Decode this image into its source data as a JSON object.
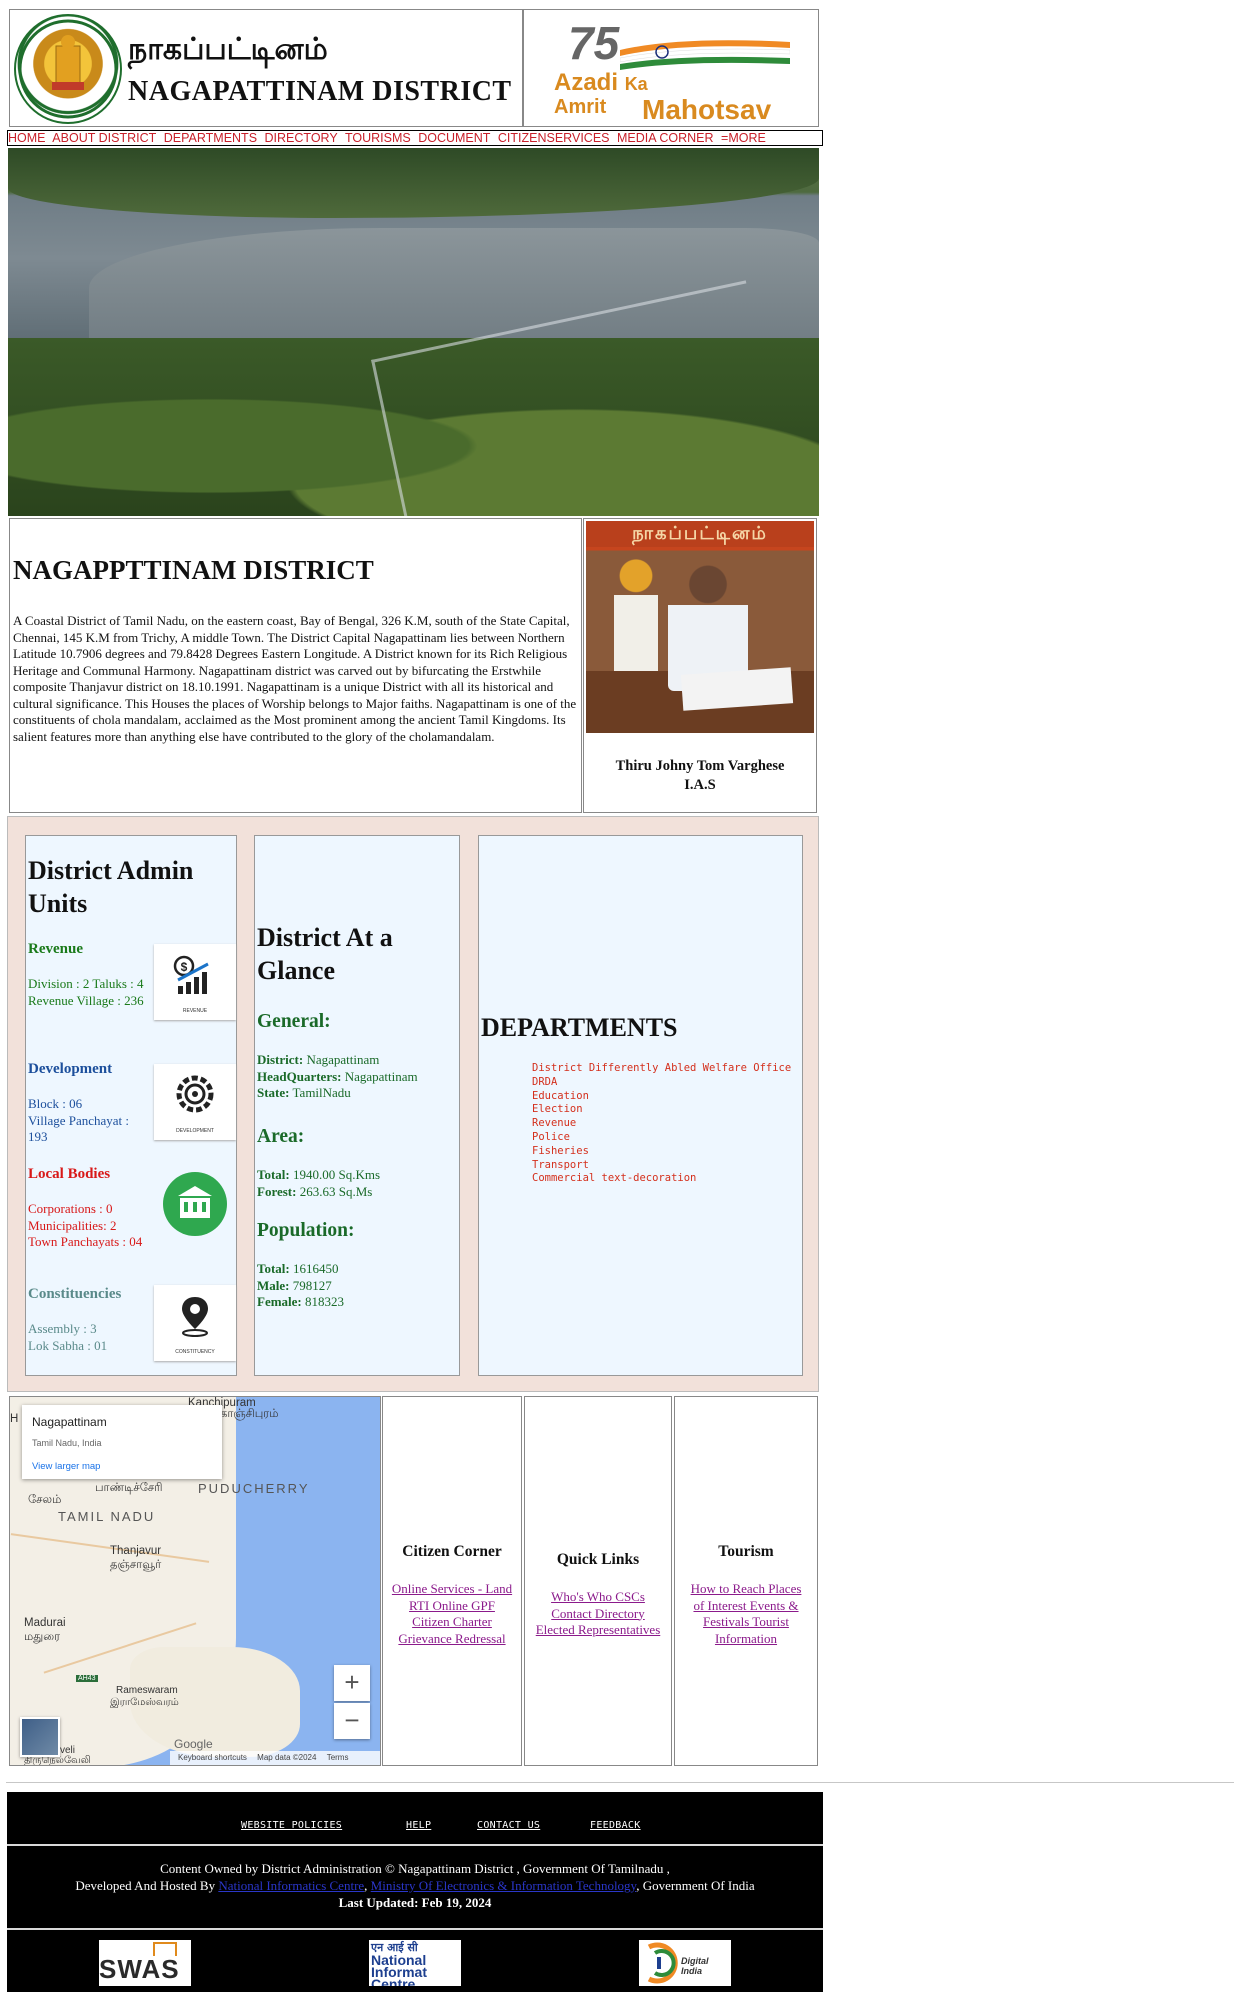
{
  "header": {
    "title_tamil": "நாகப்பட்டினம்",
    "title_english": "NAGAPATTINAM DISTRICT",
    "emblem_alt": "Government of Tamil Nadu emblem",
    "azadi": {
      "number": "75",
      "line1": "Azadi",
      "ka": "Ka",
      "line2a": "Amrit",
      "line2b": "Mahotsav"
    }
  },
  "nav": {
    "items": [
      "HOME",
      "ABOUT DISTRICT",
      "DEPARTMENTS",
      "DIRECTORY",
      "TOURISMS",
      "DOCUMENT",
      "CITIZENSERVICES",
      "MEDIA CORNER",
      "=MORE"
    ]
  },
  "intro": {
    "heading": "NAGAPPTTINAM DISTRICT",
    "paragraph": "A Coastal District of Tamil Nadu, on the eastern coast, Bay of Bengal, 326 K.M, south of the State Capital, Chennai, 145 K.M from Trichy, A middle Town. The District Capital Nagapattinam lies between Northern Latitude 10.7906 degrees and 79.8428 Degrees Eastern Longitude. A District known for its Rich Religious Heritage and Communal Harmony. Nagapattinam district was carved out by bifurcating the Erstwhile composite Thanjavur district on 18.10.1991. Nagapattinam is a unique District with all its historical and cultural significance. This Houses the places of Worship belongs to Major faiths. Nagapattinam is one of the constituents of chola mandalam, acclaimed as the Most prominent among the ancient Tamil Kingdoms. Its salient features more than anything else have contributed to the glory of the cholamandalam."
  },
  "collector": {
    "banner": "நாகப்பட்டினம்",
    "name_line1": "Thiru Johny Tom Varghese",
    "name_line2": "I.A.S"
  },
  "admin_units": {
    "heading": "District Admin Units",
    "units": [
      {
        "title": "Revenue",
        "lines": [
          "Division : 2 Taluks : 4",
          "Revenue Village : 236"
        ],
        "color": "#1a7a1a",
        "icon": "revenue-icon",
        "caption": "REVENUE"
      },
      {
        "title": "Development",
        "lines": [
          "Block : 06",
          "Village Panchayat : 193"
        ],
        "color": "#1c4f9c",
        "icon": "development-icon",
        "caption": "DEVELOPMENT"
      },
      {
        "title": "Local Bodies",
        "lines": [
          "Corporations : 0",
          "Municipalities: 2",
          "Town Panchayats : 04"
        ],
        "color": "#d81818",
        "icon": "local-bodies-icon",
        "caption": ""
      },
      {
        "title": "Constituencies",
        "lines": [
          "Assembly : 3",
          "Lok Sabha : 01"
        ],
        "color": "#5a8a8a",
        "icon": "constituency-icon",
        "caption": "CONSTITUENCY"
      }
    ]
  },
  "glance": {
    "heading": "District At a Glance",
    "general_heading": "General:",
    "general": [
      {
        "k": "District:",
        "v": " Nagapattinam"
      },
      {
        "k": "HeadQuarters:",
        "v": " Nagapattinam"
      },
      {
        "k": "State:",
        "v": " TamilNadu"
      }
    ],
    "area_heading": "Area:",
    "area": [
      {
        "k": "Total:",
        "v": " 1940.00 Sq.Kms"
      },
      {
        "k": "Forest:",
        "v": " 263.63 Sq.Ms"
      }
    ],
    "population_heading": "Population:",
    "population": [
      {
        "k": "Total:",
        "v": " 1616450"
      },
      {
        "k": "Male:",
        "v": " 798127"
      },
      {
        "k": "Female:",
        "v": " 818323"
      }
    ]
  },
  "departments": {
    "heading": "DEPARTMENTS",
    "items": [
      "District Differently Abled Welfare Office",
      "DRDA",
      "Education",
      "Election",
      "Revenue",
      "Police",
      "Fisheries",
      "Transport",
      "Commercial text-decoration"
    ]
  },
  "map": {
    "card_title": "Nagapattinam",
    "card_sub": "Tamil Nadu, India",
    "card_link": "View larger map",
    "labels": {
      "kanchipuram": "Kanchipuram",
      "kanchipuram_ta": "காஞ்சிபுரம்",
      "puducherry": "PUDUCHERRY",
      "puducherry_ta": "பாண்டிச்சேரி",
      "salem_ta": "சேலம்",
      "tamil_nadu": "TAMIL NADU",
      "thanjavur": "Thanjavur",
      "thanjavur_ta": "தஞ்சாவூர்",
      "madurai": "Madurai",
      "madurai_ta": "மதுரை",
      "rameswaram": "Rameswaram",
      "rameswaram_ta": "இராமேஸ்வரம்",
      "road": "AH43",
      "google": "Google",
      "bottom_left": "veli",
      "bottom_left_ta": "திருநெல்வேலி",
      "h": "H"
    },
    "footer": [
      "Keyboard shortcuts",
      "Map data ©2024",
      "Terms"
    ],
    "zoom_in": "+",
    "zoom_out": "−"
  },
  "citizen_corner": {
    "heading": "Citizen Corner",
    "links": [
      "Online Services - Land",
      "RTI Online GPF",
      "Citizen Charter",
      "Grievance Redressal"
    ]
  },
  "quick_links": {
    "heading": "Quick Links",
    "links": [
      "Who's Who CSCs",
      "Contact Directory",
      "Elected Representatives"
    ]
  },
  "tourism": {
    "heading": "Tourism",
    "links": [
      "How to Reach Places",
      "of Interest Events &",
      "Festivals Tourist",
      "Information"
    ]
  },
  "footer": {
    "links": [
      "WEBSITE POLICIES",
      "HELP",
      "CONTACT US",
      "FEEDBACK"
    ],
    "line1": "Content Owned by District Administration © Nagapattinam District , Government Of Tamilnadu ,",
    "line2_prefix": "Developed And Hosted By ",
    "nic": "National Informatics Centre",
    "sep": ", ",
    "meity": "Ministry Of Electronics & Information Technology",
    "line2_suffix": ", Government Of India",
    "updated": "Last Updated: Feb 19, 2024",
    "logos": {
      "swaas": "SWAS",
      "nic_hi": "एन आई सी",
      "nic1": "National",
      "nic2": "Informat",
      "nic3": "Centre",
      "digital": "Digital India"
    }
  },
  "colors": {
    "nav_text": "#c8202a",
    "panel_bg": "#eef7ff",
    "section_bg": "#f2e1da",
    "link": "#8b1a8b",
    "glance": "#1a6a29",
    "dept": "#d4301d"
  }
}
